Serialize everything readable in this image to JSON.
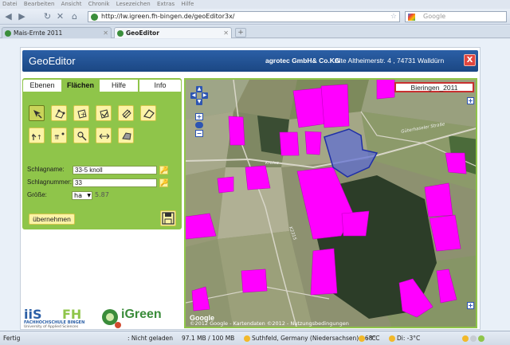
{
  "browser": {
    "menu": [
      "Datei",
      "Bearbeiten",
      "Ansicht",
      "Chronik",
      "Lesezeichen",
      "Extras",
      "Hilfe"
    ],
    "url": "http://lw.igreen.fh-bingen.de/geoEditor3x/",
    "search_placeholder": "Google",
    "tabs": [
      {
        "title": "Mais-Ernte 2011",
        "active": false
      },
      {
        "title": "GeoEditor",
        "active": true
      }
    ],
    "new_tab": "+"
  },
  "app": {
    "title": "GeoEditor",
    "company": "agrotec GmbH& Co.KG",
    "address": "Alte Altheimerstr. 4 , 74731 Walldürn",
    "close_label": "X"
  },
  "panel": {
    "tabs": [
      "Ebenen",
      "Flächen",
      "Hilfe",
      "Info"
    ],
    "active_tab": "Flächen",
    "tools": [
      "select-icon",
      "vertex-edit-icon",
      "add-polygon-icon",
      "add-part-icon",
      "cut-polygon-icon",
      "measure-icon",
      "move-icon",
      "merge-icon",
      "split-icon",
      "distance-icon",
      "area-icon"
    ],
    "form": {
      "name_label": "Schlagname:",
      "name_value": "33-5 knoll",
      "number_label": "Schlagnummer:",
      "number_value": "33",
      "size_label": "Größe:",
      "unit": "ha",
      "size_value": "5.87"
    },
    "apply_label": "übernehmen"
  },
  "logos": {
    "fh_line1": "FACHHOCHSCHULE BINGEN",
    "fh_line2": "University of Applied Sciences",
    "igreen": "iGreen"
  },
  "map": {
    "label": "Bieringen_2011",
    "google": "Google",
    "copyright": "©2012 Google - Kartendaten ©2012 - Nutzungsbedingungen",
    "roads": [
      "Güterhaseler Straße",
      "Kreise",
      "K2315"
    ],
    "field_color": "#ff00ff",
    "selected_color": "#5b6bd6"
  },
  "status": {
    "left": "Fertig",
    "not_loaded": ": Nicht geladen",
    "memory": "97.1 MB / 100 MB",
    "location": "Suthfeld, Germany (Niedersachsen): -6°C",
    "forecast1": "-8°C",
    "forecast2": "Di: -3°C"
  }
}
